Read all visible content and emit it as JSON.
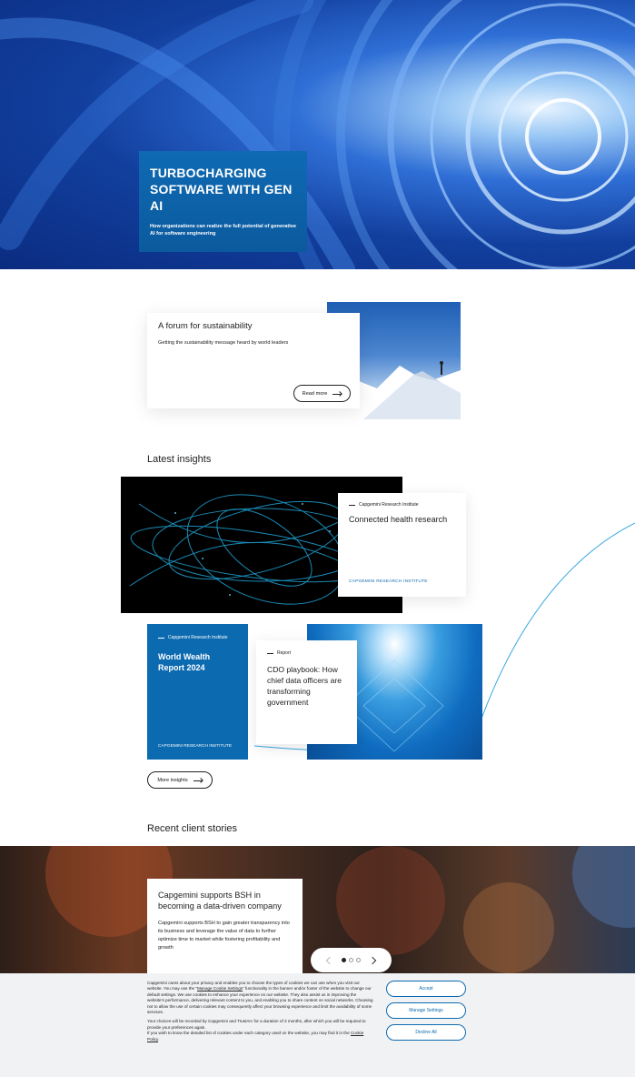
{
  "hero": {
    "title": "TURBOCHARGING SOFTWARE WITH GEN AI",
    "subtitle": "How organizations can realize the full potential of generative AI for software engineering"
  },
  "forum": {
    "title": "A forum for sustainability",
    "text": "Getting the sustainability message heard by world leaders",
    "button": "Read more"
  },
  "insights": {
    "heading": "Latest insights",
    "cards": [
      {
        "tag": "Capgemini Research Institute",
        "title": "Connected health research",
        "footer": "CAPGEMINI RESEARCH INSTITUTE"
      },
      {
        "tag": "Capgemini Research Institute",
        "title": "World Wealth Report 2024",
        "footer": "CAPGEMINI RESEARCH INSTITUTE"
      },
      {
        "tag": "Report",
        "title": "CDO playbook: How chief data officers are transforming government"
      }
    ],
    "more_button": "More insights"
  },
  "stories": {
    "heading": "Recent client stories",
    "card_title": "Capgemini supports BSH in becoming a data-driven company",
    "card_text": "Capgemini supports BSH to gain greater transparency into its business and leverage the value of data to further optimize time to market while fostering profitability and growth"
  },
  "cookie": {
    "p1_a": "Capgemini cares about your privacy and enables you to choose the types of cookies we can use when you visit our website. You may use the \"",
    "p1_link": "Manage Cookie Settings",
    "p1_b": "\" functionality in the banner and/or footer of the website to change our default settings. We use cookies to enhance your experience on our website. They also assist us in improving the website's performance, delivering relevant content to you, and enabling you to share content on social networks. Choosing not to allow the use of certain cookies may consequently affect your browsing experience and limit the availability of some services.",
    "p2": "Your choices will be recorded by Capgemini and TrustArc for a duration of 3 months, after which you will be required to provide your preferences again.",
    "p3_a": "If you wish to know the detailed list of cookies under each category used on the website, you may find it in the ",
    "p3_link": "Cookie Policy",
    "p3_b": ".",
    "accept": "Accept",
    "manage": "Manage Settings",
    "decline": "Decline All"
  },
  "colors": {
    "brand_blue": "#0b6ab0"
  }
}
